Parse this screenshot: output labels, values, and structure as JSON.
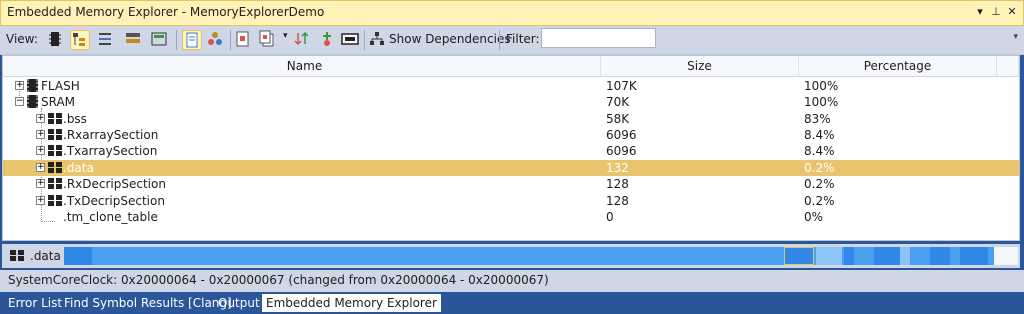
{
  "window": {
    "title": "Embedded Memory Explorer - MemoryExplorerDemo"
  },
  "toolbar": {
    "view_label": "View:",
    "show_dependencies_label": "Show Dependencies",
    "filter_label": "Filter:",
    "filter_value": ""
  },
  "grid": {
    "columns": [
      "Name",
      "Size",
      "Percentage"
    ],
    "rows": [
      {
        "name": "FLASH",
        "size": "107K",
        "percentage": "100%"
      },
      {
        "name": "SRAM",
        "size": "70K",
        "percentage": "100%"
      },
      {
        "name": ".bss",
        "size": "58K",
        "percentage": "83%"
      },
      {
        "name": ".RxarraySection",
        "size": "6096",
        "percentage": "8.4%"
      },
      {
        "name": ".TxarraySection",
        "size": "6096",
        "percentage": "8.4%"
      },
      {
        "name": ".data",
        "size": "132",
        "percentage": "0.2%"
      },
      {
        "name": ".RxDecripSection",
        "size": "128",
        "percentage": "0.2%"
      },
      {
        "name": ".TxDecripSection",
        "size": "128",
        "percentage": "0.2%"
      },
      {
        "name": ".tm_clone_table",
        "size": "0",
        "percentage": "0%"
      }
    ]
  },
  "memory_map": {
    "label": ".data"
  },
  "status": {
    "text": "SystemCoreClock: 0x20000064 - 0x20000067 (changed from 0x20000064 - 0x20000067)"
  },
  "tabs": [
    "Error List",
    "Find Symbol Results [Clang]",
    "Output",
    "Embedded Memory Explorer"
  ],
  "colors": {
    "selection": "#e8c56d",
    "accent": "#2b579a",
    "map_blue": "#4aa0f0"
  }
}
